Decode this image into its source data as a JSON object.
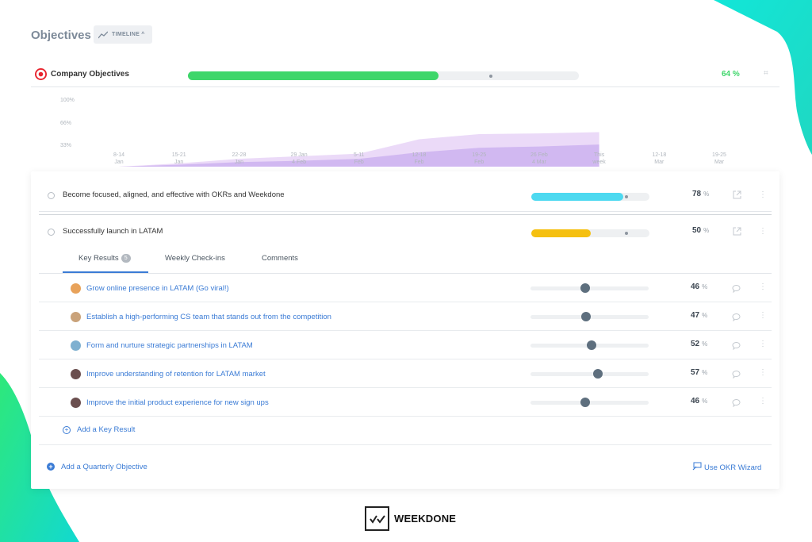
{
  "header": {
    "title": "Objectives",
    "timeline_label": "TIMELINE ^"
  },
  "company": {
    "label": "Company Objectives",
    "progress_pct": 64,
    "pct_label": "64 %",
    "progress_color": "#3ed66a"
  },
  "chart_data": {
    "type": "area",
    "y_ticks": [
      "100%",
      "66%",
      "33%"
    ],
    "x_ticks": [
      "8-14\nJan",
      "15-21\nJan",
      "22-28\nJan",
      "29 Jan\n4 Feb",
      "5-11\nFeb",
      "12-18\nFeb",
      "19-25\nFeb",
      "26 Feb\n4 Mar",
      "This\nweek",
      "12-18\nMar",
      "19-25\nMar"
    ],
    "series": [
      {
        "values": [
          0,
          0.05,
          0.12,
          0.16,
          0.2,
          0.42,
          0.5,
          0.51,
          0.53
        ]
      },
      {
        "values": [
          0,
          0.03,
          0.07,
          0.09,
          0.12,
          0.22,
          0.29,
          0.31,
          0.34
        ]
      }
    ],
    "ylim": [
      0,
      1
    ],
    "colors": [
      "#e8d3f7",
      "#cdb2f0"
    ]
  },
  "objectives": [
    {
      "label": "Become focused, aligned, and effective with OKRs and Weekdone",
      "progress": 78,
      "pct": "78",
      "color": "#4dd9f0"
    },
    {
      "label": "Successfully launch in LATAM",
      "progress": 50,
      "pct": "50",
      "color": "#f5c010"
    }
  ],
  "pct_unit": "%",
  "tabs": {
    "key_results": "Key Results",
    "key_results_count": "5",
    "weekly_checkins": "Weekly Check-ins",
    "comments": "Comments"
  },
  "key_results": [
    {
      "label": "Grow online presence in LATAM (Go viral!)",
      "progress": 46,
      "pct": "46",
      "avatar": "#e8a25a"
    },
    {
      "label": "Establish a high-performing CS team that stands out from the competition",
      "progress": 47,
      "pct": "47",
      "avatar": "#c9a27a"
    },
    {
      "label": "Form and nurture strategic partnerships in LATAM",
      "progress": 52,
      "pct": "52",
      "avatar": "#7fb0d0"
    },
    {
      "label": "Improve understanding of retention for LATAM market",
      "progress": 57,
      "pct": "57",
      "avatar": "#6b4f4f"
    },
    {
      "label": "Improve the initial product experience for new sign ups",
      "progress": 46,
      "pct": "46",
      "avatar": "#6b4f4f"
    }
  ],
  "actions": {
    "add_key_result": "Add a Key Result",
    "add_objective": "Add a Quarterly Objective",
    "okr_wizard": "Use OKR Wizard"
  },
  "brand": {
    "name": "WEEKDONE"
  }
}
